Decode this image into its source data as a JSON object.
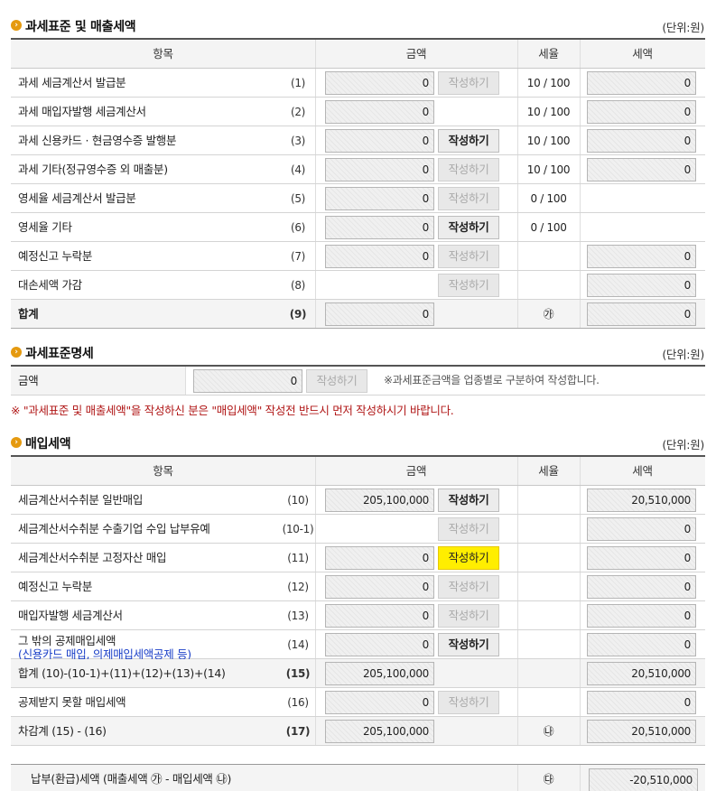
{
  "sales": {
    "title": "과세표준 및 매출세액",
    "unit": "(단위:원)",
    "headers": [
      "항목",
      "금액",
      "세율",
      "세액"
    ],
    "rows": [
      {
        "label": "과세 세금계산서 발급분",
        "num": "(1)",
        "amount": "0",
        "button": "작성하기",
        "button_state": "disabled",
        "rate": "10 / 100",
        "tax": "0"
      },
      {
        "label": "과세 매입자발행 세금계산서",
        "num": "(2)",
        "amount": "0",
        "button": "",
        "button_state": "none",
        "rate": "10 / 100",
        "tax": "0"
      },
      {
        "label": "과세 신용카드 · 현금영수증 발행분",
        "num": "(3)",
        "amount": "0",
        "button": "작성하기",
        "button_state": "enabled",
        "rate": "10 / 100",
        "tax": "0"
      },
      {
        "label": "과세 기타(정규영수증 외 매출분)",
        "num": "(4)",
        "amount": "0",
        "button": "작성하기",
        "button_state": "disabled",
        "rate": "10 / 100",
        "tax": "0"
      },
      {
        "label": "영세율 세금계산서 발급분",
        "num": "(5)",
        "amount": "0",
        "button": "작성하기",
        "button_state": "disabled",
        "rate": "0 / 100",
        "tax": null
      },
      {
        "label": "영세율 기타",
        "num": "(6)",
        "amount": "0",
        "button": "작성하기",
        "button_state": "enabled",
        "rate": "0 / 100",
        "tax": null
      },
      {
        "label": "예정신고 누락분",
        "num": "(7)",
        "amount": "0",
        "button": "작성하기",
        "button_state": "disabled",
        "rate": "",
        "tax": "0"
      },
      {
        "label": "대손세액 가감",
        "num": "(8)",
        "amount": null,
        "button": "작성하기",
        "button_state": "disabled",
        "rate": "",
        "tax": "0"
      }
    ],
    "total": {
      "label": "합계",
      "num": "(9)",
      "amount": "0",
      "rate": "㉮",
      "tax": "0"
    }
  },
  "base": {
    "title": "과세표준명세",
    "unit": "(단위:원)",
    "label": "금액",
    "amount": "0",
    "button": "작성하기",
    "note": "※과세표준금액을 업종별로 구분하여 작성합니다."
  },
  "warning": "※ \"과세표준 및 매출세액\"을 작성하신 분은 \"매입세액\" 작성전 반드시 먼저 작성하시기 바랍니다.",
  "purchase": {
    "title": "매입세액",
    "unit": "(단위:원)",
    "headers": [
      "항목",
      "금액",
      "세율",
      "세액"
    ],
    "rows": [
      {
        "label": "세금계산서수취분 일반매입",
        "num": "(10)",
        "amount": "205,100,000",
        "button": "작성하기",
        "button_state": "enabled",
        "tax": "20,510,000"
      },
      {
        "label": "세금계산서수취분 수출기업 수입 납부유예",
        "num": "(10-1)",
        "amount": null,
        "button": "작성하기",
        "button_state": "disabled",
        "tax": "0"
      },
      {
        "label": "세금계산서수취분 고정자산 매입",
        "num": "(11)",
        "amount": "0",
        "button": "작성하기",
        "button_state": "highlighted",
        "tax": "0"
      },
      {
        "label": "예정신고 누락분",
        "num": "(12)",
        "amount": "0",
        "button": "작성하기",
        "button_state": "disabled",
        "tax": "0"
      },
      {
        "label": "매입자발행 세금계산서",
        "num": "(13)",
        "amount": "0",
        "button": "작성하기",
        "button_state": "disabled",
        "tax": "0"
      },
      {
        "label": "그 밖의 공제매입세액",
        "sublabel": "(신용카드 매입, 의제매입세액공제 등)",
        "num": "(14)",
        "amount": "0",
        "button": "작성하기",
        "button_state": "enabled",
        "tax": "0"
      },
      {
        "label": "합계 (10)-(10-1)+(11)+(12)+(13)+(14)",
        "num": "(15)",
        "amount": "205,100,000",
        "button": "",
        "button_state": "none",
        "tax": "20,510,000",
        "grey": true
      },
      {
        "label": "공제받지 못할 매입세액",
        "num": "(16)",
        "amount": "0",
        "button": "작성하기",
        "button_state": "disabled",
        "tax": "0"
      },
      {
        "label": "차감계 (15) - (16)",
        "num": "(17)",
        "amount": "205,100,000",
        "button": "",
        "button_state": "none",
        "rate": "㉯",
        "tax": "20,510,000",
        "grey": true
      }
    ]
  },
  "payable": {
    "label": "납부(환급)세액 (매출세액 ㉮ - 매입세액 ㉯)",
    "rate": "㉰",
    "tax": "-20,510,000"
  },
  "colors": {
    "bullet": "#e59a10",
    "highlight": "#ffee00",
    "warning": "#b01616",
    "blue_text": "#1a3fc7"
  }
}
